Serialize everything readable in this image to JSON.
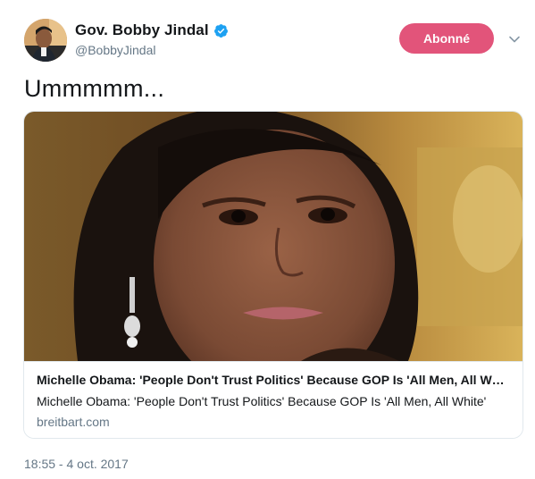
{
  "author": {
    "display_name": "Gov. Bobby Jindal",
    "handle": "@BobbyJindal",
    "verified": true
  },
  "follow_button": {
    "label": "Abonné",
    "color": "#e2547a"
  },
  "tweet": {
    "text": "Ummmmm...",
    "timestamp": "18:55 - 4 oct. 2017"
  },
  "card": {
    "title": "Michelle Obama: 'People Don't Trust Politics' Because GOP Is 'All Men, All White'",
    "description": "Michelle Obama: 'People Don't Trust Politics' Because GOP Is 'All Men, All White'",
    "domain": "breitbart.com"
  },
  "icons": {
    "verified": "verified-badge-icon",
    "menu": "chevron-down-icon"
  },
  "colors": {
    "accent": "#1da1f2",
    "secondary_text": "#657786"
  }
}
